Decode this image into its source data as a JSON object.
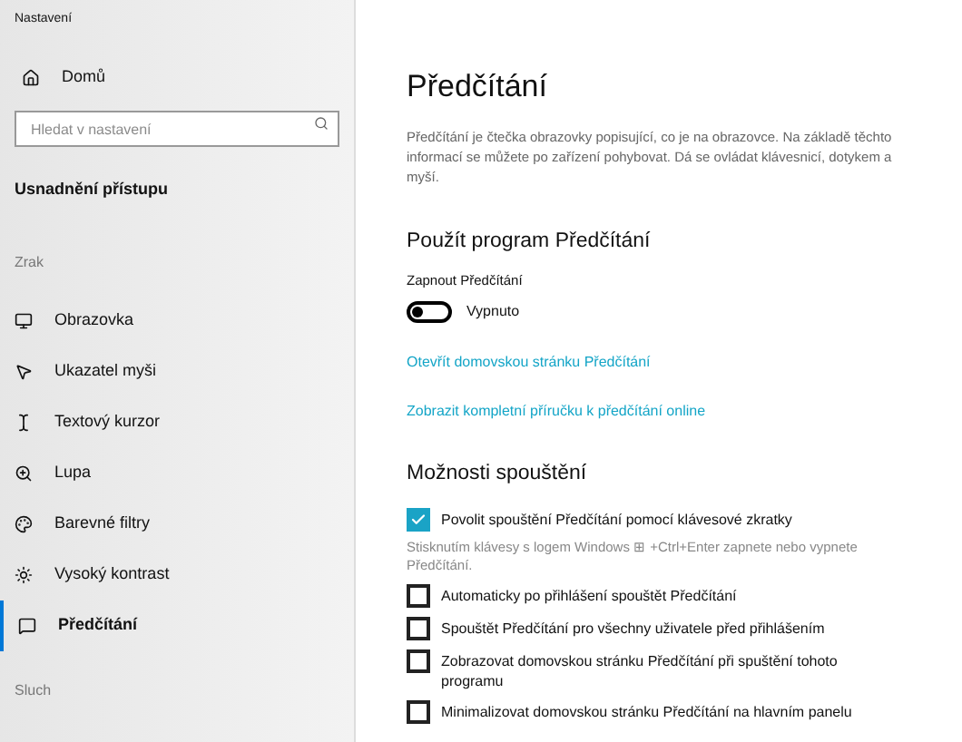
{
  "window": {
    "title": "Nastavení"
  },
  "sidebar": {
    "home": "Domů",
    "search": {
      "placeholder": "Hledat v nastavení"
    },
    "section": "Usnadnění přístupu",
    "groups": [
      {
        "label": "Zrak",
        "items": [
          {
            "label": "Obrazovka",
            "kind": "monitor",
            "selected": false
          },
          {
            "label": "Ukazatel myši",
            "kind": "pointer",
            "selected": false
          },
          {
            "label": "Textový kurzor",
            "kind": "cursor",
            "selected": false
          },
          {
            "label": "Lupa",
            "kind": "zoom",
            "selected": false
          },
          {
            "label": "Barevné filtry",
            "kind": "filter",
            "selected": false
          },
          {
            "label": "Vysoký kontrast",
            "kind": "contrast",
            "selected": false
          },
          {
            "label": "Předčítání",
            "kind": "narrator",
            "selected": true
          }
        ]
      },
      {
        "label": "Sluch"
      }
    ]
  },
  "main": {
    "title": "Předčítání",
    "description": "Předčítání je čtečka obrazovky popisující, co je na obrazovce. Na základě těchto informací se můžete po zařízení pohybovat. Dá se ovládat klávesnicí, dotykem a myší.",
    "use_section": {
      "heading": "Použít program Předčítání",
      "toggle": {
        "label": "Zapnout Předčítání",
        "on": false,
        "state_text": "Vypnuto"
      },
      "links": [
        "Otevřít domovskou stránku Předčítání",
        "Zobrazit kompletní příručku k předčítání online"
      ]
    },
    "startup_section": {
      "heading": "Možnosti spouštění",
      "options": [
        {
          "label": "Povolit spouštění Předčítání pomocí klávesové zkratky",
          "checked": true,
          "hint": "Stisknutím klávesy s logem Windows ⊞ +Ctrl+Enter zapnete nebo vypnete Předčítání."
        },
        {
          "label": "Automaticky po přihlášení spouštět Předčítání",
          "checked": false
        },
        {
          "label": "Spouštět Předčítání pro všechny uživatele před přihlášením",
          "checked": false
        },
        {
          "label": "Zobrazovat domovskou stránku Předčítání při spuštění tohoto programu",
          "checked": false
        },
        {
          "label": "Minimalizovat domovskou stránku Předčítání na hlavním panelu",
          "checked": false
        }
      ]
    }
  }
}
